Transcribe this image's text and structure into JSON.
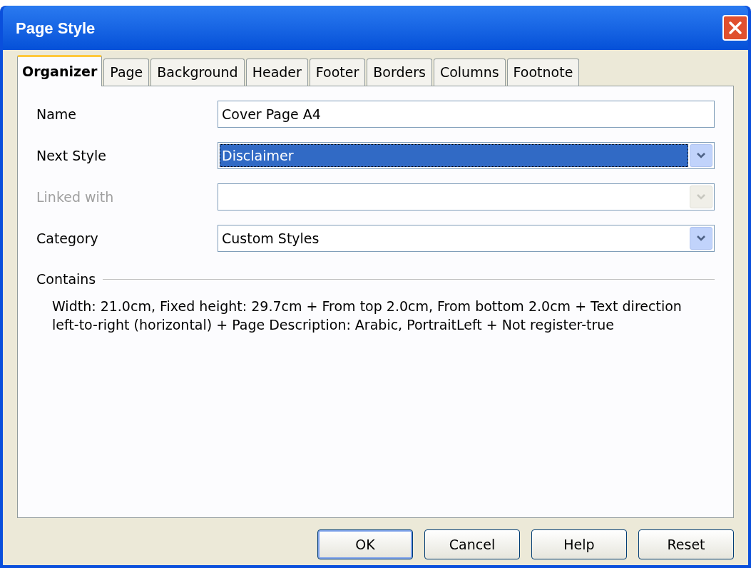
{
  "window": {
    "title": "Page Style"
  },
  "tabs": [
    {
      "label": "Organizer",
      "selected": true
    },
    {
      "label": "Page",
      "selected": false
    },
    {
      "label": "Background",
      "selected": false
    },
    {
      "label": "Header",
      "selected": false
    },
    {
      "label": "Footer",
      "selected": false
    },
    {
      "label": "Borders",
      "selected": false
    },
    {
      "label": "Columns",
      "selected": false
    },
    {
      "label": "Footnote",
      "selected": false
    }
  ],
  "fields": [
    {
      "kind": "text",
      "label": "Name",
      "value": "Cover Page A4",
      "disabled": false,
      "focused": false
    },
    {
      "kind": "dropdown",
      "label": "Next Style",
      "value": "Disclaimer",
      "disabled": false,
      "focused": true
    },
    {
      "kind": "dropdown",
      "label": "Linked with",
      "disabled": true,
      "focused": false
    },
    {
      "kind": "dropdown",
      "label": "Category",
      "value": "Custom Styles",
      "disabled": false,
      "focused": false
    }
  ],
  "contains": {
    "heading": "Contains",
    "text": "Width: 21.0cm, Fixed height: 29.7cm + From top 2.0cm, From bottom 2.0cm + Text direction left-to-right (horizontal) + Page Description: Arabic, PortraitLeft + Not register-true"
  },
  "buttons": [
    {
      "label": "OK",
      "default": true
    },
    {
      "label": "Cancel",
      "default": false
    },
    {
      "label": "Help",
      "default": false
    },
    {
      "label": "Reset",
      "default": false
    }
  ]
}
